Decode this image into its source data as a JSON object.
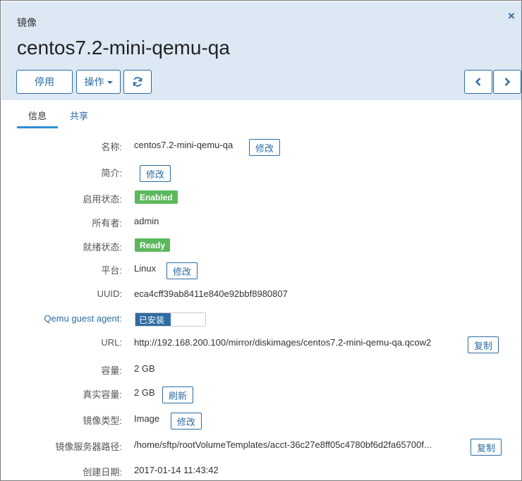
{
  "header": {
    "subtitle": "镜像",
    "title": "centos7.2-mini-qemu-qa",
    "close_icon": "×",
    "toolbar": {
      "disable_label": "停用",
      "actions_label": "操作",
      "refresh_icon": "refresh-icon",
      "prev_icon": "chevron-left-icon",
      "next_icon": "chevron-right-icon"
    }
  },
  "tabs": {
    "info": "信息",
    "share": "共享"
  },
  "fields": {
    "name": {
      "label": "名称:",
      "value": "centos7.2-mini-qemu-qa",
      "action": "修改"
    },
    "description": {
      "label": "简介:",
      "action": "修改"
    },
    "enable_state": {
      "label": "启用状态:",
      "badge": "Enabled"
    },
    "owner": {
      "label": "所有者:",
      "value": "admin"
    },
    "ready_state": {
      "label": "就绪状态:",
      "badge": "Ready"
    },
    "platform": {
      "label": "平台:",
      "value": "Linux",
      "action": "修改"
    },
    "uuid": {
      "label": "UUID:",
      "value": "eca4cff39ab8411e840e92bbf8980807"
    },
    "qemu_agent": {
      "label": "Qemu guest agent:",
      "toggle_on": "已安装"
    },
    "url": {
      "label": "URL:",
      "value": "http://192.168.200.100/mirror/diskimages/centos7.2-mini-qemu-qa.qcow2",
      "action": "复制"
    },
    "size": {
      "label": "容量:",
      "value": "2 GB"
    },
    "actual_size": {
      "label": "真实容量:",
      "value": "2 GB",
      "action": "刷新"
    },
    "image_type": {
      "label": "镜像类型:",
      "value": "Image",
      "action": "修改"
    },
    "server_path": {
      "label": "镜像服务器路径:",
      "value": "/home/sftp/rootVolumeTemplates/acct-36c27e8ff05c4780bf6d2fa65700f...",
      "action": "复制"
    },
    "created": {
      "label": "创建日期:",
      "value": "2017-01-14 11:43:42"
    }
  },
  "colors": {
    "accent": "#2d6ca2",
    "header_bg": "#dde8f5",
    "success": "#5cb85c",
    "tab_underline": "#2d8fd5"
  }
}
